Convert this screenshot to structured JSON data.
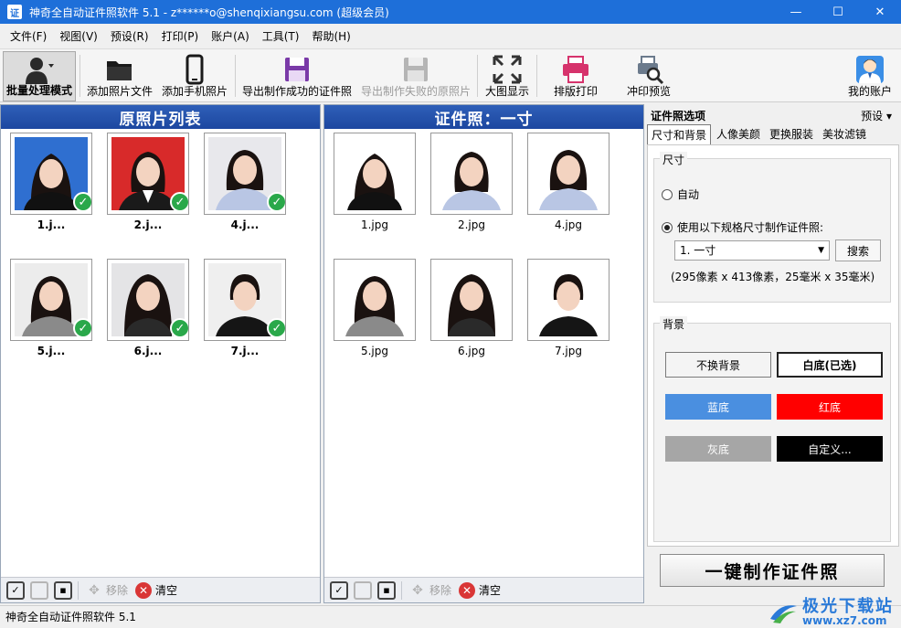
{
  "window": {
    "title": "神奇全自动证件照软件 5.1 - z******o@shenqixiangsu.com (超级会员)",
    "icon_label": "证",
    "minimize": "—",
    "maximize": "☐",
    "close": "✕"
  },
  "menu": [
    "文件(F)",
    "视图(V)",
    "预设(R)",
    "打印(P)",
    "账户(A)",
    "工具(T)",
    "帮助(H)"
  ],
  "toolbar": {
    "batch_mode": "批量处理模式",
    "add_photo_file": "添加照片文件",
    "add_phone_photo": "添加手机照片",
    "export_success": "导出制作成功的证件照",
    "export_failed": "导出制作失败的原照片",
    "large_view": "大图显示",
    "layout_print": "排版打印",
    "print_preview": "冲印预览",
    "my_account": "我的账户"
  },
  "left_panel": {
    "title": "原照片列表",
    "items": [
      {
        "label": "1.j...",
        "bg": "#2f6fd0",
        "checked": true
      },
      {
        "label": "2.j...",
        "bg": "#d82a2a",
        "checked": true
      },
      {
        "label": "4.j...",
        "bg": "#e8e8ec",
        "checked": true
      },
      {
        "label": "5.j...",
        "bg": "#ececec",
        "checked": true
      },
      {
        "label": "6.j...",
        "bg": "#e4e4e6",
        "checked": true
      },
      {
        "label": "7.j...",
        "bg": "#efefef",
        "checked": true
      }
    ],
    "bottom": {
      "remove": "移除",
      "clear": "清空"
    }
  },
  "middle_panel": {
    "title": "证件照：一寸",
    "items": [
      {
        "label": "1.jpg"
      },
      {
        "label": "2.jpg"
      },
      {
        "label": "4.jpg"
      },
      {
        "label": "5.jpg"
      },
      {
        "label": "6.jpg"
      },
      {
        "label": "7.jpg"
      }
    ],
    "bottom": {
      "remove": "移除",
      "clear": "清空"
    }
  },
  "options": {
    "title": "证件照选项",
    "preset": "预设 ▾",
    "tabs": [
      "尺寸和背景",
      "人像美颜",
      "更换服装",
      "美妆滤镜"
    ],
    "size_group": "尺寸",
    "radio_auto": "自动",
    "radio_spec": "使用以下规格尺寸制作证件照:",
    "spec_value": "1. 一寸",
    "search": "搜索",
    "spec_info": "(295像素 x 413像素，25毫米 x 35毫米)",
    "bg_group": "背景",
    "bg_buttons": {
      "no_change": "不换背景",
      "white": "白底(已选)",
      "blue": "蓝底",
      "red": "红底",
      "gray": "灰底",
      "custom": "自定义..."
    },
    "make_button": "一键制作证件照"
  },
  "status": "神奇全自动证件照软件 5.1",
  "watermark": {
    "cn": "极光下载站",
    "url": "www.xz7.com"
  },
  "colors": {
    "accent": "#1e6fd9",
    "check": "#2aa84a",
    "blue_bg": "#4a8fe0",
    "red_bg": "#ff0000",
    "gray_bg": "#a6a6a6"
  }
}
